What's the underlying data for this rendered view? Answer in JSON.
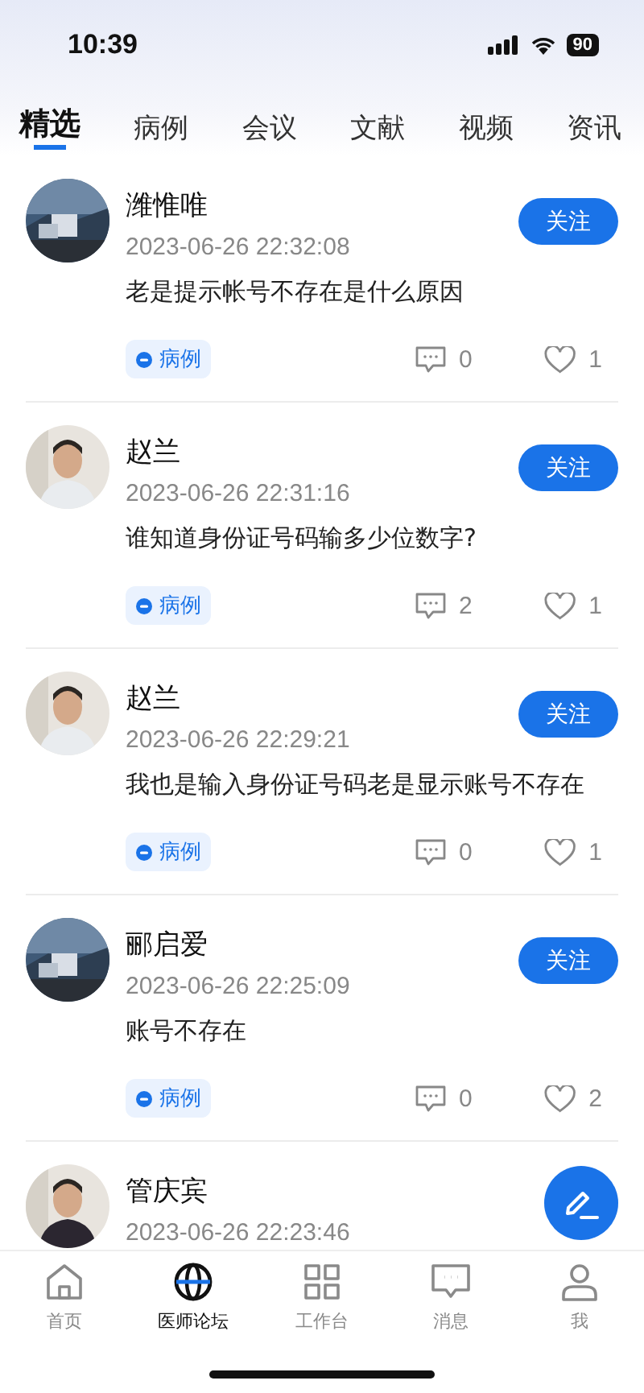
{
  "status_bar": {
    "time": "10:39",
    "battery": "90"
  },
  "tabs": [
    {
      "label": "精选",
      "selected": true
    },
    {
      "label": "病例",
      "selected": false
    },
    {
      "label": "会议",
      "selected": false
    },
    {
      "label": "文献",
      "selected": false
    },
    {
      "label": "视频",
      "selected": false
    },
    {
      "label": "资讯",
      "selected": false
    }
  ],
  "posts": [
    {
      "name": "潍惟唯",
      "time": "2023-06-26 22:32:08",
      "text": "老是提示帐号不存在是什么原因",
      "follow": "关注",
      "tag": "病例",
      "comments": "0",
      "likes": "1"
    },
    {
      "name": "赵兰",
      "time": "2023-06-26 22:31:16",
      "text": "谁知道身份证号码输多少位数字?",
      "follow": "关注",
      "tag": "病例",
      "comments": "2",
      "likes": "1"
    },
    {
      "name": "赵兰",
      "time": "2023-06-26 22:29:21",
      "text": "我也是输入身份证号码老是显示账号不存在",
      "follow": "关注",
      "tag": "病例",
      "comments": "0",
      "likes": "1"
    },
    {
      "name": "郦启爱",
      "time": "2023-06-26 22:25:09",
      "text": "账号不存在",
      "follow": "关注",
      "tag": "病例",
      "comments": "0",
      "likes": "2"
    },
    {
      "name": "管庆宾",
      "time": "2023-06-26 22:23:46"
    }
  ],
  "bottom_nav": [
    {
      "label": "首页",
      "selected": false
    },
    {
      "label": "医师论坛",
      "selected": true
    },
    {
      "label": "工作台",
      "selected": false
    },
    {
      "label": "消息",
      "selected": false
    },
    {
      "label": "我",
      "selected": false
    }
  ]
}
